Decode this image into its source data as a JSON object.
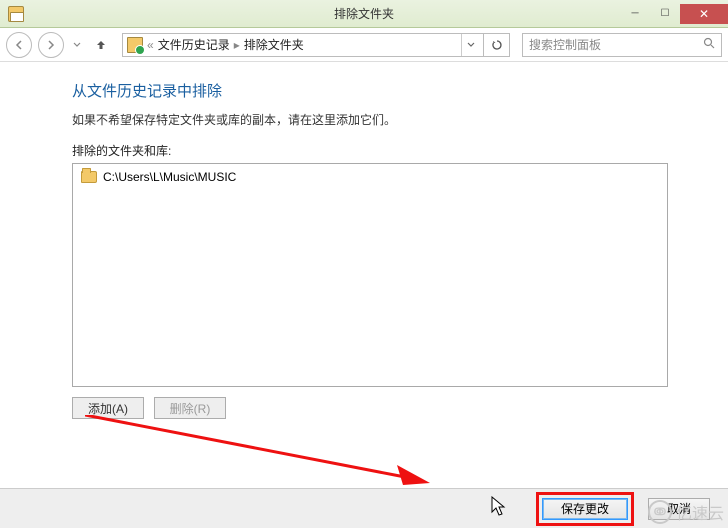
{
  "title": "排除文件夹",
  "breadcrumb": {
    "sep_lead": "«",
    "seg1": "文件历史记录",
    "seg2": "排除文件夹"
  },
  "search": {
    "placeholder": "搜索控制面板"
  },
  "page": {
    "heading": "从文件历史记录中排除",
    "subtext": "如果不希望保存特定文件夹或库的副本，请在这里添加它们。",
    "list_label": "排除的文件夹和库:",
    "items": [
      {
        "path": "C:\\Users\\L\\Music\\MUSIC"
      }
    ]
  },
  "buttons": {
    "add": "添加(A)",
    "remove": "删除(R)",
    "save": "保存更改",
    "cancel": "取消"
  },
  "watermark": "亿速云"
}
